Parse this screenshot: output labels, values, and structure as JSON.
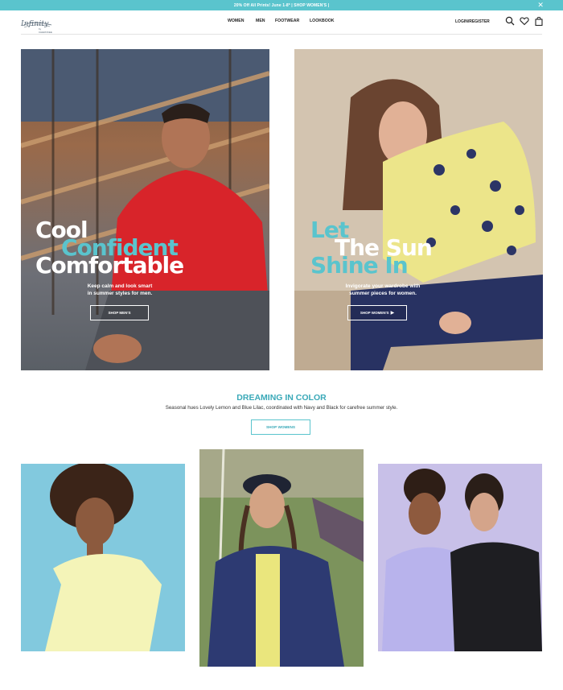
{
  "promo": {
    "text": "20% Off All Prints! June 1-8* | SHOP WOMEN'S |",
    "close": "✕"
  },
  "brand": {
    "logo_text": "Infinity",
    "logo_subtext": "by CHEROKEE"
  },
  "nav": {
    "items": [
      "WOMEN",
      "MEN",
      "FOOTWEAR",
      "LOOKBOOK"
    ],
    "login": "LOGIN/REGISTER",
    "icons": [
      "search-icon",
      "heart-icon",
      "bag-icon"
    ]
  },
  "hero_men": {
    "headline": [
      "Cool",
      "Confident",
      "Comfortable"
    ],
    "subtext_1": "Keep calm and look smart",
    "subtext_2": "in summer styles for men.",
    "button": "SHOP MEN'S"
  },
  "hero_women": {
    "headline": [
      "Let",
      "The Sun",
      "Shine In"
    ],
    "subtext_1": "Invigorate your wardrobe with",
    "subtext_2": "summer pieces for women.",
    "button": "SHOP WOMEN'S"
  },
  "section": {
    "title": "DREAMING IN COLOR",
    "description": "Seasonal hues Lovely Lemon and Blue Lilac, coordinated with Navy and Black for carefree summer style.",
    "button": "SHOP WOMENS"
  },
  "colors": {
    "accent": "#5ac4cd",
    "accent_dark": "#3aa9b8",
    "white": "#ffffff"
  }
}
